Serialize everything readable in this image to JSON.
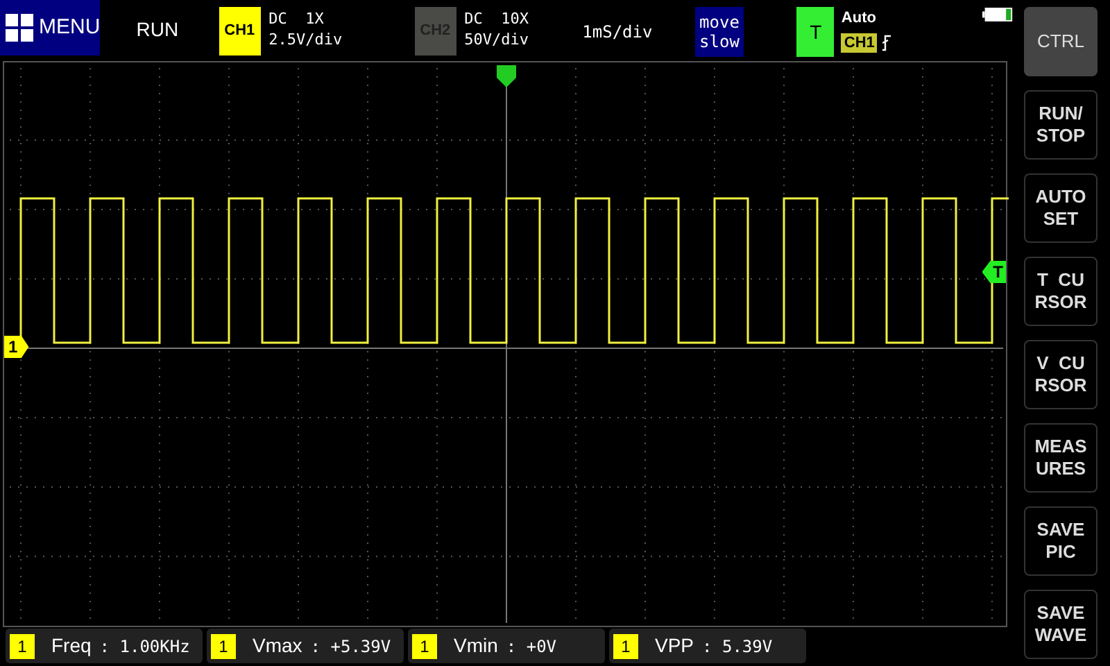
{
  "menu": {
    "label": "MENU"
  },
  "run_state": "RUN",
  "channels": [
    {
      "label": "CH1",
      "active": true,
      "coupling": "DC  1X",
      "scale": "2.5V/div"
    },
    {
      "label": "CH2",
      "active": false,
      "coupling": "DC  10X",
      "scale": "50V/div"
    }
  ],
  "timebase": "1mS/div",
  "move_speed": [
    "move",
    "slow"
  ],
  "trigger": {
    "label": "T",
    "mode": "Auto",
    "source": "CH1"
  },
  "plot": {
    "channel_marker": "1",
    "trigger_marker": "T"
  },
  "measurements": [
    {
      "channel": "1",
      "name": "Freq",
      "value": ": 1.00KHz"
    },
    {
      "channel": "1",
      "name": "Vmax",
      "value": ": +5.39V"
    },
    {
      "channel": "1",
      "name": "Vmin",
      "value": ": +0V"
    },
    {
      "channel": "1",
      "name": "VPP",
      "value": ": 5.39V"
    }
  ],
  "sidebar": [
    {
      "label": [
        "CTRL"
      ],
      "selected": true
    },
    {
      "label": [
        "RUN/",
        "STOP"
      ],
      "selected": false
    },
    {
      "label": [
        "AUTO",
        "SET"
      ],
      "selected": false
    },
    {
      "label": [
        "T  CU",
        "RSOR"
      ],
      "selected": false
    },
    {
      "label": [
        "V  CU",
        "RSOR"
      ],
      "selected": false
    },
    {
      "label": [
        "MEAS",
        "URES"
      ],
      "selected": false
    },
    {
      "label": [
        "SAVE",
        "PIC"
      ],
      "selected": false
    },
    {
      "label": [
        "SAVE",
        "WAVE"
      ],
      "selected": false
    }
  ]
}
